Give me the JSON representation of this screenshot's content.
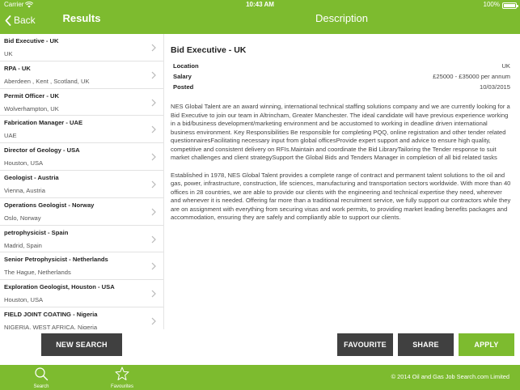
{
  "status_bar": {
    "carrier": "Carrier",
    "time": "10:43 AM",
    "battery": "100%"
  },
  "nav": {
    "back_label": "Back",
    "left_title": "Results",
    "right_title": "Description"
  },
  "results": [
    {
      "title": "Bid Executive - UK",
      "location": "UK"
    },
    {
      "title": "RPA - UK",
      "location": "Aberdeen , Kent  , Scotland, UK"
    },
    {
      "title": "Permit Officer - UK",
      "location": "Wolverhampton, UK"
    },
    {
      "title": "Fabrication Manager - UAE",
      "location": "UAE"
    },
    {
      "title": "Director of Geology - USA",
      "location": "Houston, USA"
    },
    {
      "title": "Geologist - Austria",
      "location": "Vienna, Austria"
    },
    {
      "title": "Operations Geologist - Norway",
      "location": "Oslo, Norway"
    },
    {
      "title": "petrophysicist - Spain",
      "location": "Madrid, Spain"
    },
    {
      "title": "Senior Petrophysicist - Netherlands",
      "location": "The Hague, Netherlands"
    },
    {
      "title": "Exploration Geologist, Houston - USA",
      "location": "Houston, USA"
    },
    {
      "title": "FIELD JOINT COATING - Nigeria",
      "location": "NIGERIA, WEST AFRICA, Nigeria"
    }
  ],
  "detail": {
    "title": "Bid Executive - UK",
    "location_label": "Location",
    "location": "UK",
    "salary_label": "Salary",
    "salary": "£25000 - £35000 per annum",
    "posted_label": "Posted",
    "posted": "10/03/2015",
    "paragraph1": "NES Global Talent are an award winning, international technical staffing solutions company and we are currently looking for a Bid Executive to join our team in Altrincham, Greater Manchester.  The ideal candidate will have previous experience working in a bid/business development/marketing environment and be accustomed to working in deadline driven international business environment. Key Responsibilities Be responsible for completing PQQ, online registration and other tender related questionnairesFacilitating necessary input from global officesProvide expert support and advice to ensure high quality, competitive and consistent delivery on RFIs.Maintain and coordinate the Bid LibraryTailoring the Tender response to suit market challenges and client strategySupport the Global Bids and Tenders Manager in completion of all bid related tasks",
    "paragraph2": "Established in 1978, NES Global Talent provides a complete range of contract and permanent talent solutions to the oil and gas, power, infrastructure, construction, life sciences, manufacturing and transportation sectors worldwide. With more than 40 offices in 28 countries, we are able to provide our clients with the engineering and technical expertise they need, wherever and whenever it is needed. Offering far more than a traditional recruitment service, we fully support our contractors while they are on assignment with everything from securing visas and work permits, to providing market leading benefits packages and accommodation, ensuring they are safely and compliantly able to support our clients."
  },
  "buttons": {
    "new_search": "NEW SEARCH",
    "favourite": "FAVOURITE",
    "share": "SHARE",
    "apply": "APPLY"
  },
  "tabbar": {
    "search_label": "Search",
    "favourites_label": "Favourites",
    "copyright": "© 2014 Oil and Gas Job Search.com Limited"
  },
  "colors": {
    "brand_green": "#7dbb2f",
    "dark_button": "#404040"
  }
}
